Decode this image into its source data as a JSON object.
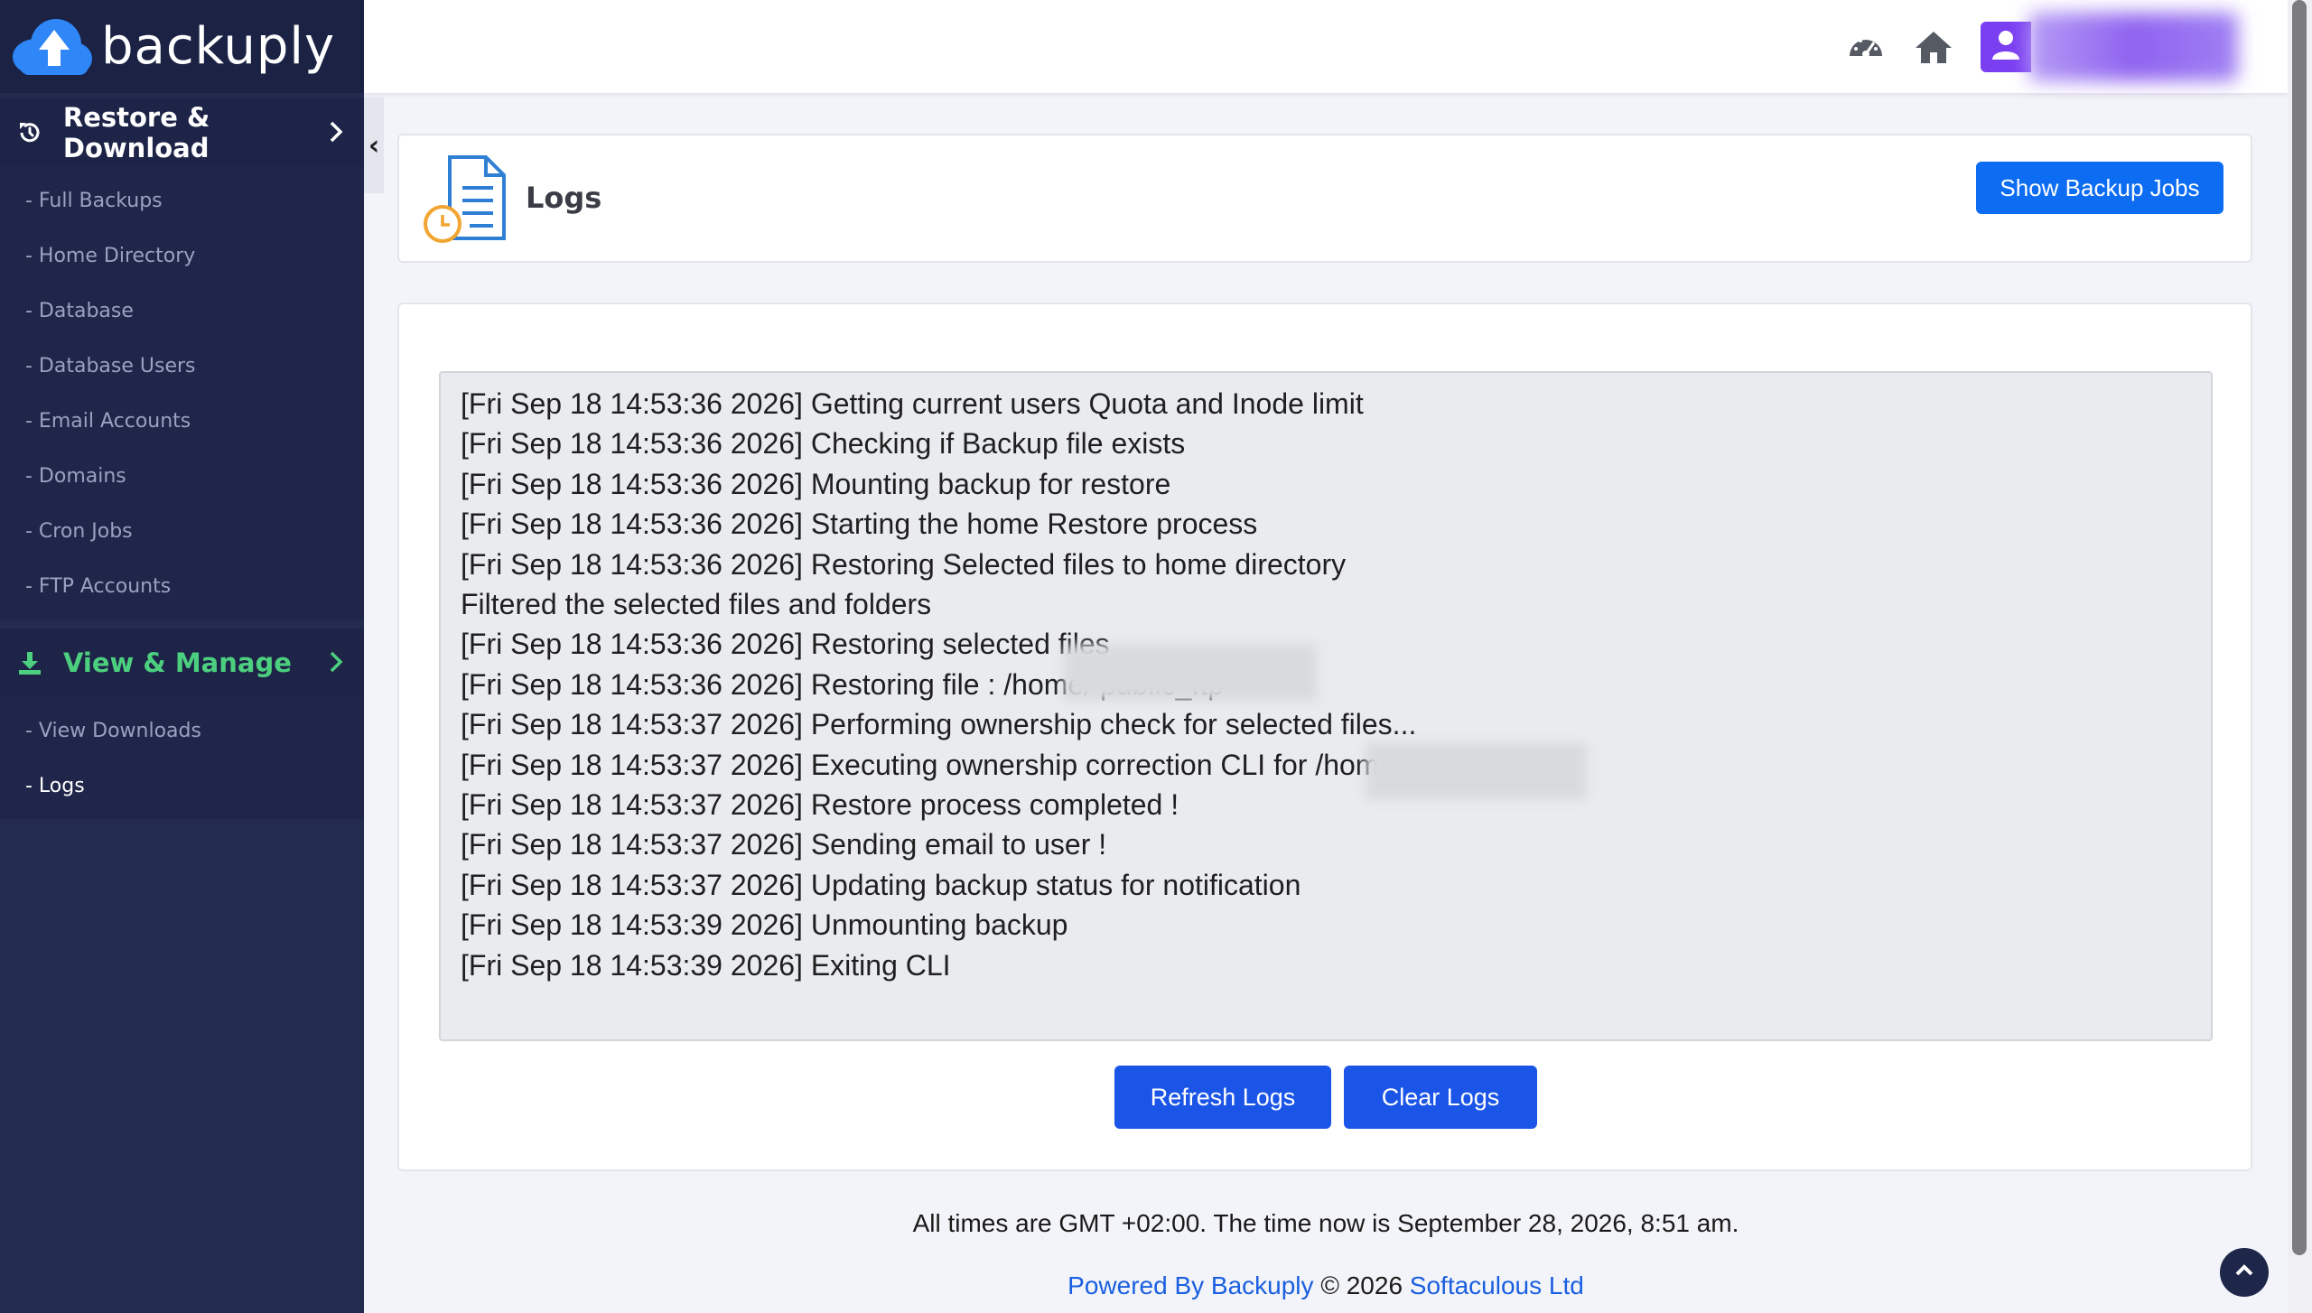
{
  "brand": {
    "name": "backuply"
  },
  "sidebar": {
    "restore_section": {
      "label": "Restore & Download",
      "items": [
        "- Full Backups",
        "- Home Directory",
        "- Database",
        "- Database Users",
        "- Email Accounts",
        "- Domains",
        "- Cron Jobs",
        "- FTP Accounts"
      ]
    },
    "view_section": {
      "label": "View & Manage",
      "items": [
        "- View Downloads",
        "- Logs"
      ],
      "active_item": "- Logs"
    },
    "collapse_glyph": "‹"
  },
  "topbar": {
    "icons": [
      "dashboard-gauge-icon",
      "home-icon",
      "user-icon"
    ]
  },
  "header": {
    "title": "Logs",
    "show_jobs_label": "Show Backup Jobs"
  },
  "logs": {
    "lines": [
      "[Fri Sep 18 14:53:36 2026] Getting current users Quota and Inode limit",
      "[Fri Sep 18 14:53:36 2026] Checking if Backup file exists",
      "[Fri Sep 18 14:53:36 2026] Mounting backup for restore",
      "[Fri Sep 18 14:53:36 2026] Starting the home Restore process",
      "[Fri Sep 18 14:53:36 2026] Restoring Selected files to home directory",
      "Filtered the selected files and folders",
      "[Fri Sep 18 14:53:36 2026] Restoring selected files",
      "[Fri Sep 18 14:53:36 2026] Restoring file : /home/                       public_ftp",
      "[Fri Sep 18 14:53:37 2026] Performing ownership check for selected files...",
      "[Fri Sep 18 14:53:37 2026] Executing ownership correction CLI for /home/                     l/public_ftp...",
      "[Fri Sep 18 14:53:37 2026] Restore process completed !",
      "[Fri Sep 18 14:53:37 2026] Sending email to user !",
      "[Fri Sep 18 14:53:37 2026] Updating backup status for notification",
      "[Fri Sep 18 14:53:39 2026] Unmounting backup",
      "[Fri Sep 18 14:53:39 2026] Exiting CLI"
    ],
    "refresh_label": "Refresh Logs",
    "clear_label": "Clear Logs"
  },
  "footer": {
    "time_note": "All times are GMT +02:00. The time now is September 28, 2026, 8:51 am.",
    "powered_by": "Powered By Backuply",
    "copyright": "© 2026",
    "company": "Softaculous Ltd"
  },
  "colors": {
    "sidebar_bg": "#232b4f",
    "accent_green": "#4ccf7e",
    "button_blue": "#1b55e8",
    "user_purple": "#7b3ff2"
  }
}
